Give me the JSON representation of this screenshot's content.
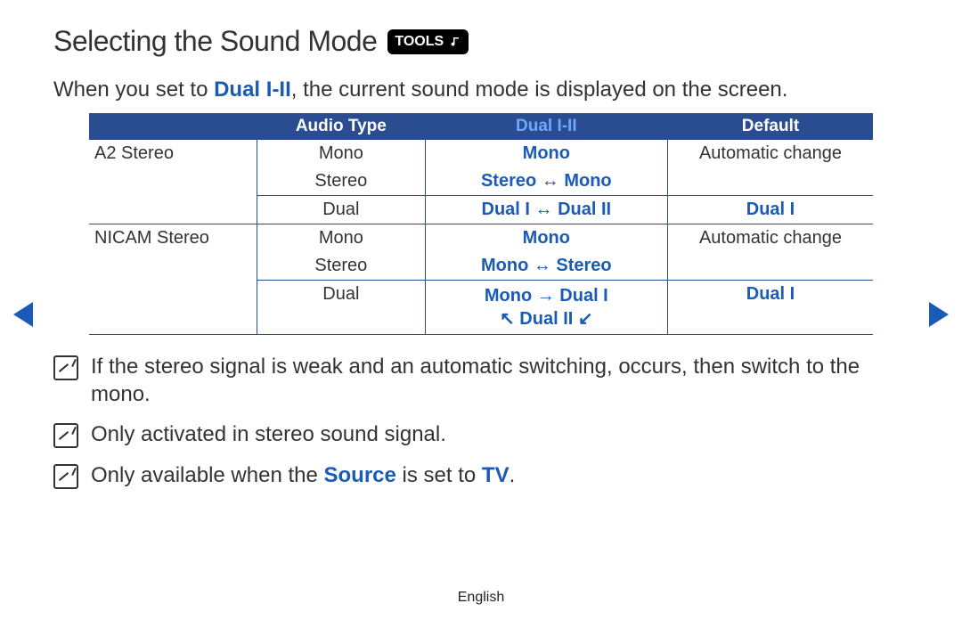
{
  "title": "Selecting the Sound Mode",
  "tools_label": "TOOLS",
  "intro_before": "When you set to ",
  "intro_dual": "Dual I-II",
  "intro_after": ", the current sound mode is displayed on the screen.",
  "table": {
    "headers": {
      "c0": "",
      "c1": "Audio Type",
      "c2": "Dual I-II",
      "c3": "Default"
    },
    "rows": [
      {
        "c0": "A2 Stereo",
        "c1": "Mono",
        "c2": "Mono",
        "c3": "Automatic change"
      },
      {
        "c0": "",
        "c1": "Stereo",
        "c2": "Stereo ↔ Mono",
        "c3": ""
      },
      {
        "c0": "",
        "c1": "Dual",
        "c2": "Dual I ↔ Dual II",
        "c3": "Dual I"
      },
      {
        "c0": "NICAM Stereo",
        "c1": "Mono",
        "c2": "Mono",
        "c3": "Automatic change"
      },
      {
        "c0": "",
        "c1": "Stereo",
        "c2": "Mono ↔ Stereo",
        "c3": ""
      },
      {
        "c0": "",
        "c1": "Dual",
        "c2a": "Mono → Dual I",
        "c2b": "↖ Dual II ↙",
        "c3": "Dual I"
      }
    ]
  },
  "notes": {
    "n1": "If the stereo signal is weak and an automatic switching, occurs, then switch to the mono.",
    "n2": "Only activated in stereo sound signal.",
    "n3a": "Only available when the ",
    "n3_source": "Source",
    "n3b": " is set to ",
    "n3_tv": "TV",
    "n3c": "."
  },
  "footer": "English"
}
